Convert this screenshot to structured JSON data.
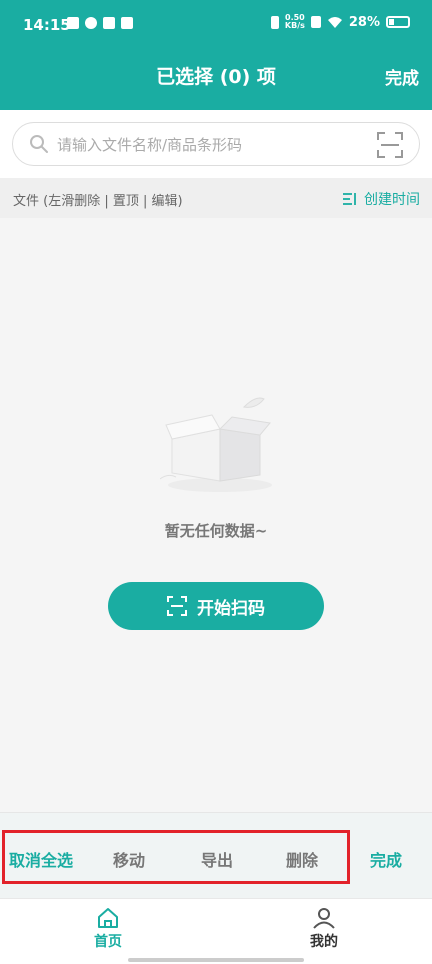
{
  "status_bar": {
    "time": "14:15",
    "net_speed_value": "0.50",
    "net_speed_unit": "KB/s",
    "battery": "28%",
    "battery_level": 0.28
  },
  "header": {
    "title": "已选择 (0) 项",
    "done_label": "完成"
  },
  "search": {
    "placeholder": "请输入文件名称/商品条形码",
    "value": ""
  },
  "list_header": {
    "hint": "文件 (左滑删除 | 置顶 | 编辑)",
    "sort_label": "创建时间"
  },
  "empty_state": {
    "message": "暂无任何数据~",
    "scan_button_label": "开始扫码"
  },
  "action_bar": {
    "cancel_select_all": "取消全选",
    "move": "移动",
    "export": "导出",
    "delete": "删除",
    "done": "完成"
  },
  "tab_bar": {
    "items": [
      {
        "label": "首页",
        "icon": "home-icon",
        "active": true
      },
      {
        "label": "我的",
        "icon": "person-icon",
        "active": false
      }
    ]
  },
  "colors": {
    "accent": "#1aada2",
    "highlight_border": "#e2222a"
  }
}
